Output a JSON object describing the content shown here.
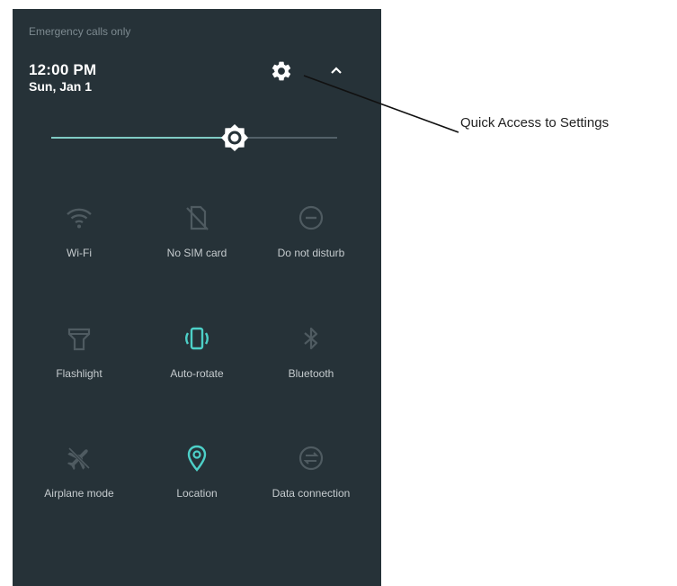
{
  "status_bar": {
    "carrier_text": "Emergency calls only"
  },
  "header": {
    "time": "12:00 PM",
    "date": "Sun, Jan 1",
    "settings_icon": "gear-icon",
    "collapse_icon": "chevron-up-icon"
  },
  "brightness": {
    "level": 0.64,
    "icon": "brightness-icon"
  },
  "tiles": [
    {
      "label": "Wi-Fi",
      "icon": "wifi-icon",
      "active": false
    },
    {
      "label": "No SIM card",
      "icon": "no-sim-icon",
      "active": false
    },
    {
      "label": "Do not disturb",
      "icon": "do-not-disturb-icon",
      "active": false
    },
    {
      "label": "Flashlight",
      "icon": "flashlight-icon",
      "active": false
    },
    {
      "label": "Auto-rotate",
      "icon": "auto-rotate-icon",
      "active": true
    },
    {
      "label": "Bluetooth",
      "icon": "bluetooth-icon",
      "active": false
    },
    {
      "label": "Airplane mode",
      "icon": "airplane-icon",
      "active": false
    },
    {
      "label": "Location",
      "icon": "location-icon",
      "active": true
    },
    {
      "label": "Data connection",
      "icon": "data-connection-icon",
      "active": false
    }
  ],
  "annotation": {
    "callout_text": "Quick Access to Settings"
  },
  "colors": {
    "panel_bg": "#263238",
    "accent": "#4dd0c8",
    "inactive_icon": "#4f5b61",
    "label_text": "#c5cbce"
  }
}
